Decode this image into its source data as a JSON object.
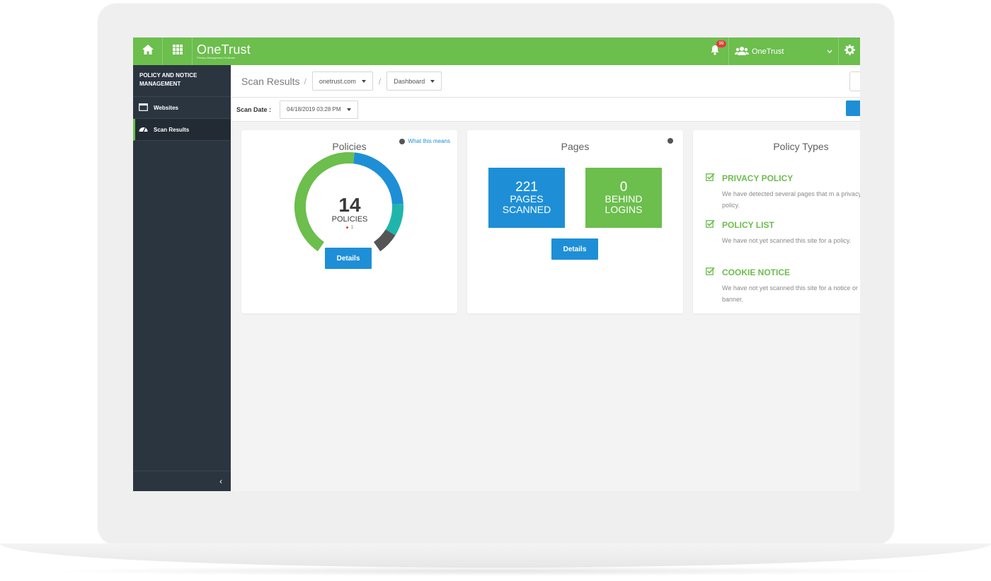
{
  "app": {
    "brand_name": "OneTrust",
    "brand_subtitle": "Privacy Management Software",
    "notification_count": "99",
    "org_name": "OneTrust"
  },
  "sidebar": {
    "title": "POLICY AND NOTICE MANAGEMENT",
    "items": [
      {
        "label": "Websites",
        "icon": "browser-window-icon",
        "active": false
      },
      {
        "label": "Scan Results",
        "icon": "dashboard-gauge-icon",
        "active": true
      }
    ],
    "collapse_glyph": "‹"
  },
  "breadcrumb": {
    "title": "Scan Results",
    "separator": "/",
    "site": "onetrust.com",
    "view": "Dashboard"
  },
  "scan": {
    "date_label": "Scan Date :",
    "date_value": "04/18/2019 03:28 PM"
  },
  "policies": {
    "title": "Policies",
    "help_link": "What this means",
    "count": "14",
    "count_label": "POLICIES",
    "legend_value": "1",
    "details_label": "Details",
    "segments": [
      {
        "name": "green",
        "fraction": 0.52,
        "color": "#6cbe4d"
      },
      {
        "name": "blue",
        "fraction": 0.28,
        "color": "#1e8fd6"
      },
      {
        "name": "teal",
        "fraction": 0.12,
        "color": "#1fb5ad"
      },
      {
        "name": "dark",
        "fraction": 0.08,
        "color": "#555555"
      }
    ]
  },
  "pages": {
    "title": "Pages",
    "scanned_count": "221",
    "scanned_label_1": "PAGES",
    "scanned_label_2": "SCANNED",
    "behind_count": "0",
    "behind_label_1": "BEHIND",
    "behind_label_2": "LOGINS",
    "details_label": "Details"
  },
  "policy_types": {
    "title": "Policy Types",
    "items": [
      {
        "name": "PRIVACY POLICY",
        "desc": "We have detected several pages that m a privacy policy."
      },
      {
        "name": "POLICY LIST",
        "desc": "We have not yet scanned this site for a policy."
      },
      {
        "name": "COOKIE NOTICE",
        "desc": "We have not yet scanned this site for a notice or banner."
      }
    ]
  },
  "colors": {
    "brand_green": "#6cbe4d",
    "accent_blue": "#1e8fd6",
    "sidebar_bg": "#2b3540"
  }
}
